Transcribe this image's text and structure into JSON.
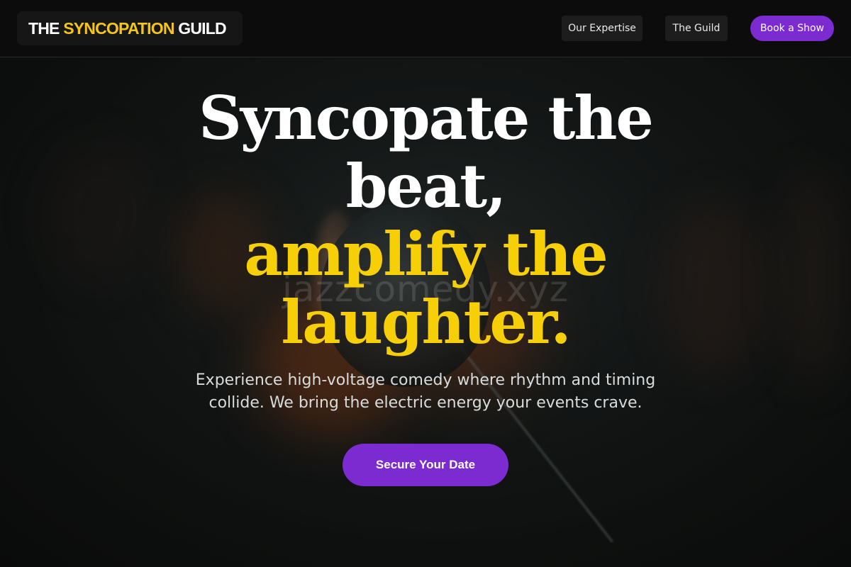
{
  "header": {
    "logo_part1": "THE",
    "logo_part2": "SYNCOPATION",
    "logo_part3": "GUILD",
    "nav": {
      "expertise": "Our Expertise",
      "guild": "The Guild",
      "book": "Book a Show"
    }
  },
  "hero": {
    "headline_line1": "Syncopate the",
    "headline_line2": "beat,",
    "headline_line3": "amplify the",
    "headline_line4": "laughter.",
    "watermark": "jazzcomedy.xyz",
    "subtext": "Experience high-voltage comedy where rhythm and timing collide. We bring the electric energy your events crave.",
    "cta_label": "Secure Your Date",
    "background_image": "microphone-photo"
  },
  "colors": {
    "accent_gold": "#f7cf07",
    "accent_purple": "#7b2bd0",
    "header_bg": "#0c0c0c"
  }
}
